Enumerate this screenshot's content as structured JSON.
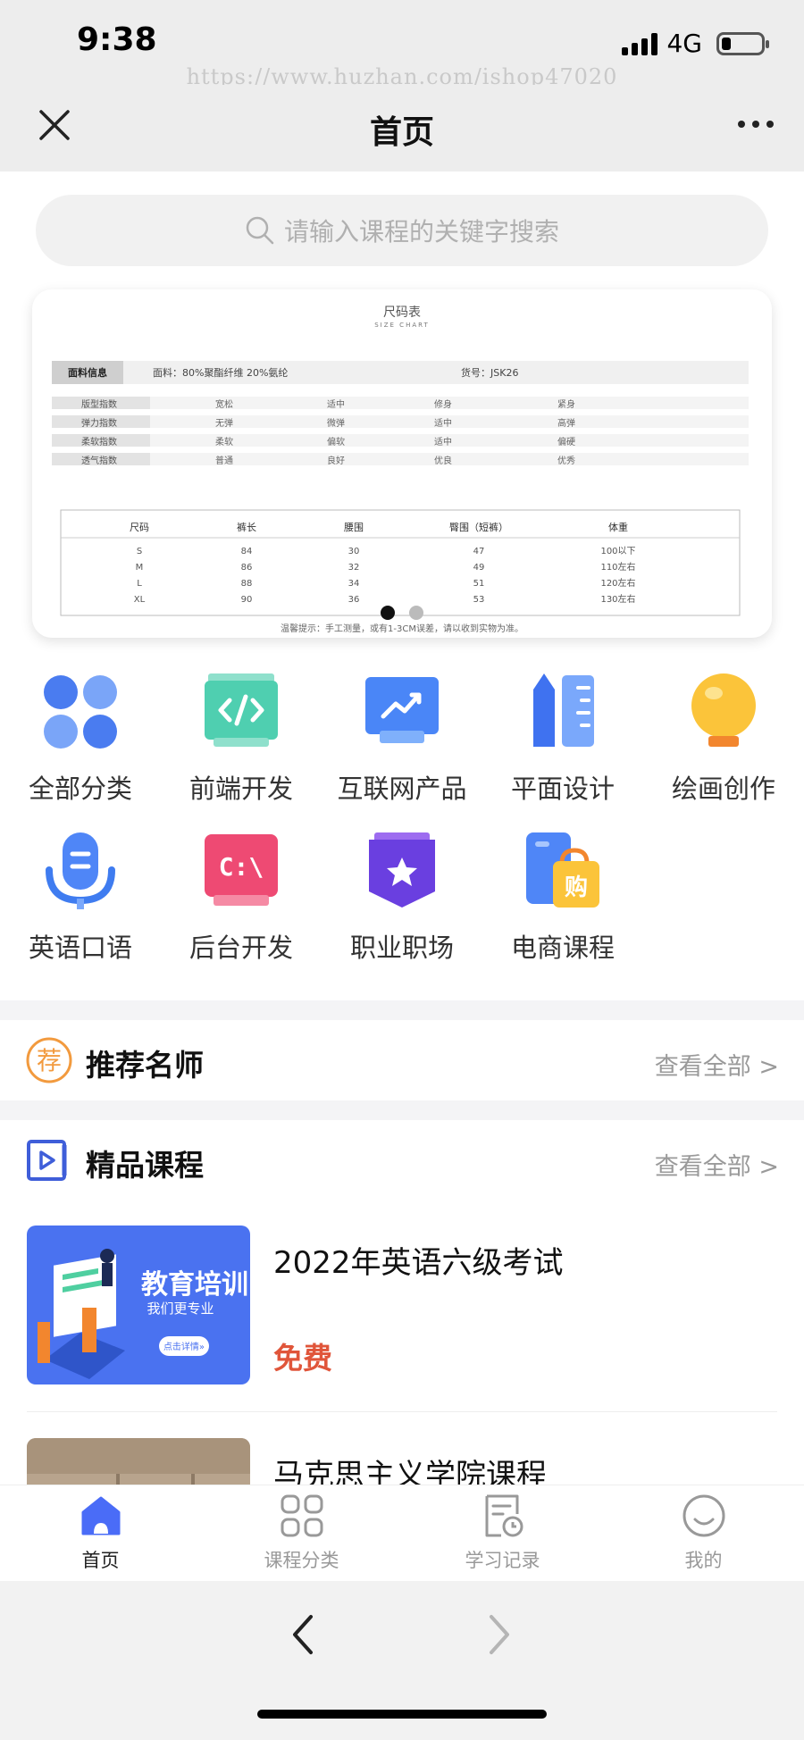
{
  "status": {
    "time": "9:38",
    "network": "4G"
  },
  "watermark": "https://www.huzhan.com/ishop47020",
  "nav": {
    "title": "首页"
  },
  "search": {
    "placeholder": "请输入课程的关键字搜索"
  },
  "banner": {
    "title": "尺码表",
    "subtitle": "SIZE CHART",
    "fabric_label": "面料信息",
    "fabric": "面料：80%聚酯纤维 20%氨纶",
    "sku": "货号：JSK26",
    "attributes": [
      {
        "name": "版型指数",
        "options": [
          "宽松",
          "适中",
          "修身",
          "紧身"
        ]
      },
      {
        "name": "弹力指数",
        "options": [
          "无弹",
          "微弹",
          "适中",
          "高弹"
        ]
      },
      {
        "name": "柔软指数",
        "options": [
          "柔软",
          "偏软",
          "适中",
          "偏硬"
        ]
      },
      {
        "name": "透气指数",
        "options": [
          "普通",
          "良好",
          "优良",
          "优秀"
        ]
      }
    ],
    "size_headers": [
      "尺码",
      "裤长",
      "腰围",
      "臀围（短裤）",
      "体重"
    ],
    "size_rows": [
      [
        "S",
        "84",
        "30",
        "47",
        "100以下"
      ],
      [
        "M",
        "86",
        "32",
        "49",
        "110左右"
      ],
      [
        "L",
        "88",
        "34",
        "51",
        "120左右"
      ],
      [
        "XL",
        "90",
        "36",
        "53",
        "130左右"
      ]
    ],
    "note": "温馨提示：手工测量，或有1-3CM误差，请以收到实物为准。",
    "slide_index": 1,
    "slide_count": 2
  },
  "categories": [
    {
      "label": "全部分类",
      "icon": "grid-dots-icon"
    },
    {
      "label": "前端开发",
      "icon": "code-icon"
    },
    {
      "label": "互联网产品",
      "icon": "trend-chart-icon"
    },
    {
      "label": "平面设计",
      "icon": "pencil-ruler-icon"
    },
    {
      "label": "绘画创作",
      "icon": "lightbulb-icon"
    },
    {
      "label": "英语口语",
      "icon": "microphone-icon"
    },
    {
      "label": "后台开发",
      "icon": "terminal-icon"
    },
    {
      "label": "职业职场",
      "icon": "badge-star-icon"
    },
    {
      "label": "电商课程",
      "icon": "shopping-bag-icon"
    }
  ],
  "sections": {
    "teachers": {
      "title": "推荐名师",
      "badge": "荐",
      "more": "查看全部 >"
    },
    "courses": {
      "title": "精品课程",
      "more": "查看全部 >"
    }
  },
  "courses": [
    {
      "title": "2022年英语六级考试",
      "price": "免费",
      "thumb_title": "教育培训",
      "thumb_sub": "我们更专业",
      "thumb_btn": "点击详情»"
    },
    {
      "title": "马克思主义学院课程",
      "price": ""
    }
  ],
  "tabs": [
    {
      "label": "首页",
      "icon": "home-icon",
      "active": true
    },
    {
      "label": "课程分类",
      "icon": "category-grid-icon",
      "active": false
    },
    {
      "label": "学习记录",
      "icon": "study-record-icon",
      "active": false
    },
    {
      "label": "我的",
      "icon": "smile-face-icon",
      "active": false
    }
  ],
  "colors": {
    "accent": "#4a6cf7",
    "price": "#e0553a",
    "tab_active": "#4a6cf7"
  }
}
